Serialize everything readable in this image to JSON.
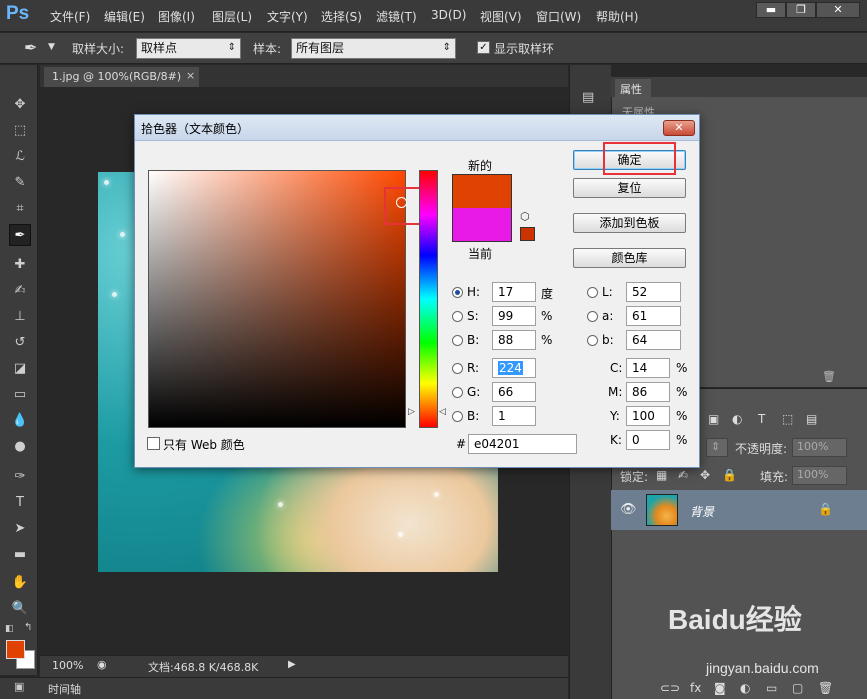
{
  "app": {
    "logo": "Ps"
  },
  "menu": [
    "文件(F)",
    "编辑(E)",
    "图像(I)",
    "图层(L)",
    "文字(Y)",
    "选择(S)",
    "滤镜(T)",
    "3D(D)",
    "视图(V)",
    "窗口(W)",
    "帮助(H)"
  ],
  "window_controls": {
    "minimize": "▬",
    "restore": "❐",
    "close": "✕"
  },
  "options": {
    "sample_size_label": "取样大小:",
    "sample_size_value": "取样点",
    "sample_label": "样本:",
    "sample_value": "所有图层",
    "show_ring_label": "显示取样环",
    "show_ring_checked": true
  },
  "document": {
    "tab_title": "1.jpg @ 100%(RGB/8#)",
    "tab_close": "×",
    "zoom": "100%",
    "doc_info": "文档:468.8 K/468.8K"
  },
  "timeline": {
    "label": "时间轴"
  },
  "colors": {
    "foreground": "#e04201",
    "background": "#ffffff"
  },
  "properties_panel": {
    "tab": "属性",
    "empty_text": "无属性"
  },
  "layers_panel": {
    "opacity_label": "不透明度:",
    "opacity_value": "100%",
    "lock_label": "锁定:",
    "fill_label": "填充:",
    "fill_value": "100%",
    "layer_name": "背景"
  },
  "color_picker": {
    "title": "拾色器（文本颜色）",
    "close": "✕",
    "new_label": "新的",
    "current_label": "当前",
    "new_color": "#e04201",
    "current_color": "#e81ae6",
    "buttons": {
      "ok": "确定",
      "reset": "复位",
      "add_swatch": "添加到色板",
      "color_libraries": "颜色库"
    },
    "hsb": {
      "h": "17",
      "h_unit": "度",
      "s": "99",
      "s_unit": "%",
      "b": "88",
      "b_unit": "%"
    },
    "rgb": {
      "r": "224",
      "g": "66",
      "b": "1"
    },
    "lab": {
      "l": "52",
      "a": "61",
      "b": "64"
    },
    "cmyk": {
      "c": "14",
      "m": "86",
      "y": "100",
      "k": "0",
      "unit": "%"
    },
    "hex_label": "#",
    "hex": "e04201",
    "web_only_label": "只有 Web 颜色",
    "field_labels": {
      "h": "H:",
      "s": "S:",
      "b_hsb": "B:",
      "r": "R:",
      "g": "G:",
      "b_rgb": "B:",
      "l": "L:",
      "a": "a:",
      "b_lab": "b:",
      "c": "C:",
      "m": "M:",
      "y": "Y:",
      "k": "K:"
    }
  },
  "watermark": {
    "logo": "Baidu经验",
    "url": "jingyan.baidu.com"
  }
}
